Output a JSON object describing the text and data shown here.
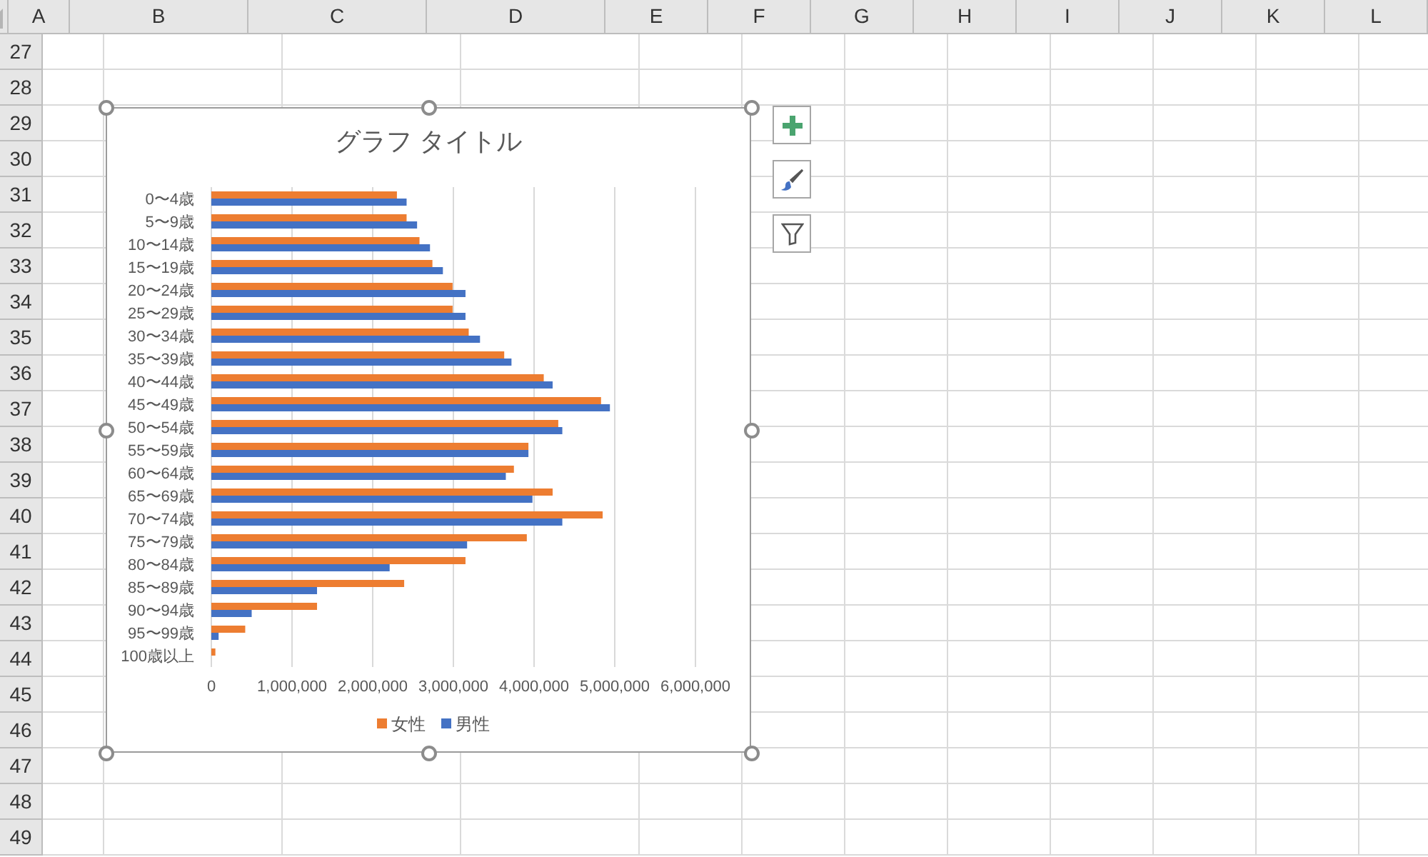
{
  "columns": [
    "A",
    "B",
    "C",
    "D",
    "E",
    "F",
    "G",
    "H",
    "I",
    "J",
    "K",
    "L"
  ],
  "rows": [
    "27",
    "28",
    "29",
    "30",
    "31",
    "32",
    "33",
    "34",
    "35",
    "36",
    "37",
    "38",
    "39",
    "40",
    "41",
    "42",
    "43",
    "44",
    "45",
    "46",
    "47",
    "48",
    "49"
  ],
  "chart": {
    "selected": true,
    "chart_data": {
      "type": "bar",
      "orientation": "horizontal",
      "title": "グラフ タイトル",
      "categories": [
        "0〜4歳",
        "5〜9歳",
        "10〜14歳",
        "15〜19歳",
        "20〜24歳",
        "25〜29歳",
        "30〜34歳",
        "35〜39歳",
        "40〜44歳",
        "45〜49歳",
        "50〜54歳",
        "55〜59歳",
        "60〜64歳",
        "65〜69歳",
        "70〜74歳",
        "75〜79歳",
        "80〜84歳",
        "85〜89歳",
        "90〜94歳",
        "95〜99歳",
        "100歳以上"
      ],
      "series": [
        {
          "name": "女性",
          "color": "#ed7d31",
          "values": [
            2300000,
            2420000,
            2580000,
            2740000,
            2990000,
            2990000,
            3190000,
            3630000,
            4120000,
            4830000,
            4300000,
            3930000,
            3750000,
            4230000,
            4850000,
            3910000,
            3150000,
            2390000,
            1310000,
            420000,
            50000
          ]
        },
        {
          "name": "男性",
          "color": "#4472c4",
          "values": [
            2420000,
            2550000,
            2710000,
            2870000,
            3150000,
            3150000,
            3330000,
            3720000,
            4230000,
            4940000,
            4350000,
            3930000,
            3650000,
            3980000,
            4350000,
            3170000,
            2210000,
            1310000,
            500000,
            90000,
            0
          ]
        }
      ],
      "xlim": [
        0,
        6000000
      ],
      "grid": true,
      "legend": true,
      "xticks": [
        {
          "value": 0,
          "label": "0"
        },
        {
          "value": 1000000,
          "label": "1,000,000"
        },
        {
          "value": 2000000,
          "label": "2,000,000"
        },
        {
          "value": 3000000,
          "label": "3,000,000"
        },
        {
          "value": 4000000,
          "label": "4,000,000"
        },
        {
          "value": 5000000,
          "label": "5,000,000"
        },
        {
          "value": 6000000,
          "label": "6,000,000"
        }
      ]
    }
  },
  "chart_tools": [
    {
      "kind": "elements"
    },
    {
      "kind": "styles"
    },
    {
      "kind": "filter"
    }
  ]
}
